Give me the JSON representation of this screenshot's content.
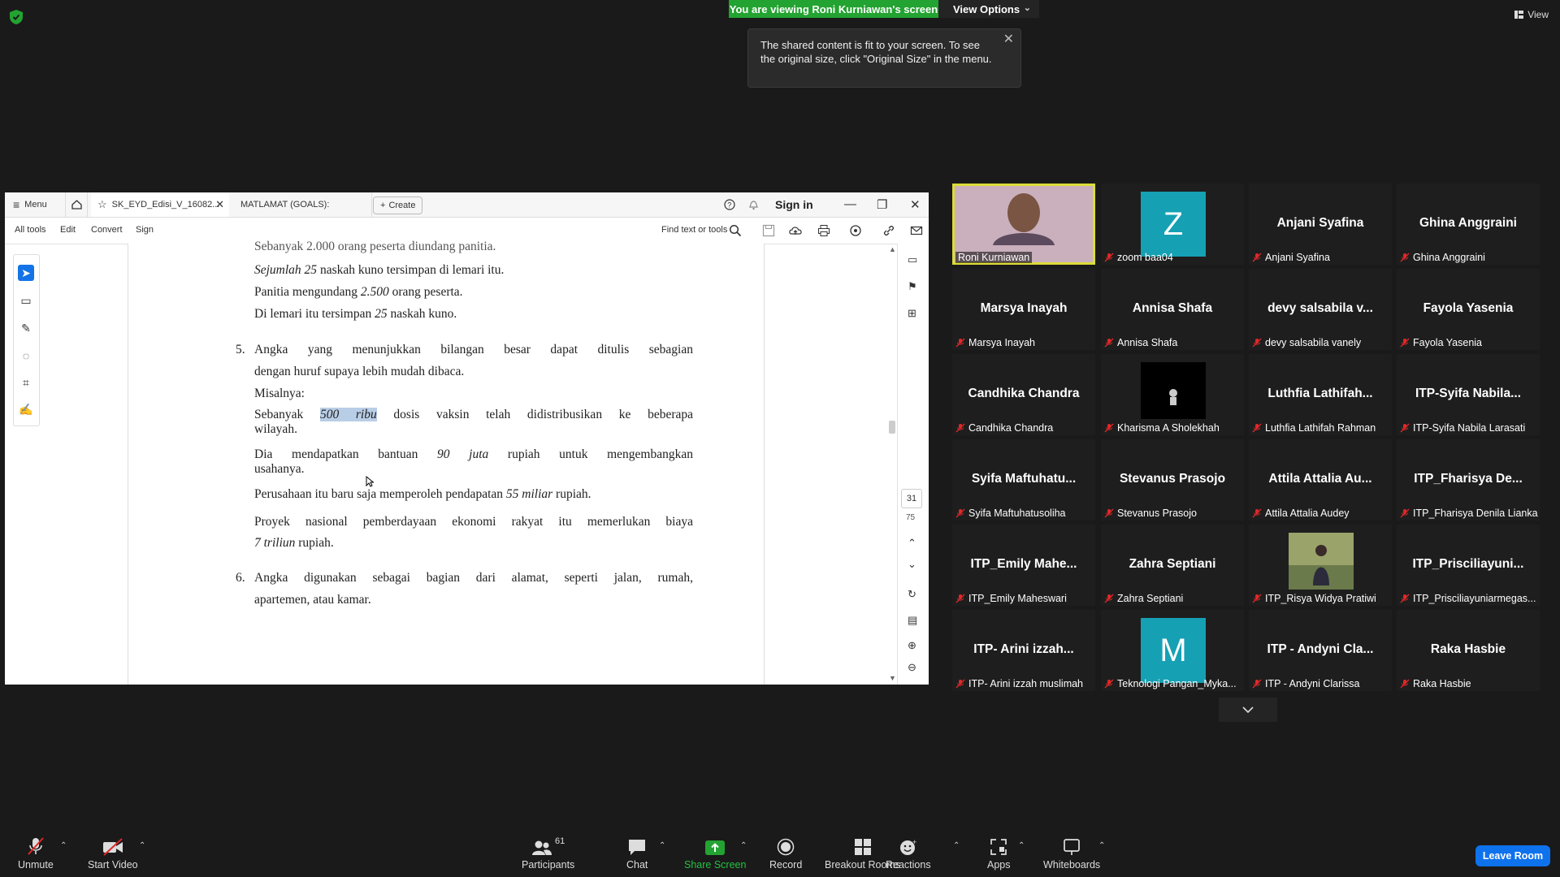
{
  "banner": {
    "viewing": "You are viewing Roni Kurniawan's screen",
    "view_options": "View Options",
    "view_top_right": "View"
  },
  "tooltip": {
    "text": "The shared content is fit to your screen. To see the original size, click \"Original Size\" in the menu."
  },
  "pdf": {
    "tabs": {
      "menu": "Menu",
      "doc": "SK_EYD_Edisi_V_16082...",
      "goals": "MATLAMAT (GOALS):",
      "create": "Create"
    },
    "sign_in": "Sign in",
    "menu2": {
      "all_tools": "All tools",
      "edit": "Edit",
      "convert": "Convert",
      "sign": "Sign",
      "find": "Find text or tools"
    },
    "page_current": "31",
    "page_total": "75",
    "lines": {
      "l0": "Sebanyak 2.000 orang peserta diundang panitia.",
      "l1a": "Sejumlah 25",
      "l1b": " naskah kuno tersimpan di lemari itu.",
      "l2a": "Panitia mengundang ",
      "l2b": "2.500",
      "l2c": " orang peserta.",
      "l3a": "Di lemari itu tersimpan ",
      "l3b": "25",
      "l3c": " naskah kuno.",
      "n5": "5.",
      "p5a": "Angka yang menunjukkan bilangan besar dapat ditulis sebagian",
      "p5b": "dengan huruf supaya lebih mudah dibaca.",
      "misal": "Misalnya:",
      "e1a": "Sebanyak ",
      "e1b": "500 ribu",
      "e1c": " dosis vaksin telah didistribusikan ke beberapa",
      "e1d": "wilayah.",
      "e2a": "Dia mendapatkan bantuan ",
      "e2b": "90 juta",
      "e2c": " rupiah untuk mengembangkan",
      "e2d": "usahanya.",
      "e3a": "Perusahaan itu baru saja memperoleh pendapatan ",
      "e3b": "55 miliar",
      "e3c": " rupiah.",
      "e4a": "Proyek nasional pemberdayaan ekonomi rakyat itu memerlukan biaya",
      "e4b": "7 triliun",
      "e4c": " rupiah.",
      "n6": "6.",
      "p6a": "Angka digunakan sebagai bagian dari alamat, seperti jalan, rumah,",
      "p6b": "apartemen, atau kamar."
    }
  },
  "participants": [
    {
      "name": "",
      "label": "Roni Kurniawan",
      "muted": false
    },
    {
      "name": "",
      "label": "zoom baa04",
      "avatar": "Z",
      "muted": true
    },
    {
      "name": "Anjani Syafina",
      "label": "Anjani Syafina",
      "muted": true
    },
    {
      "name": "Ghina Anggraini",
      "label": "Ghina Anggraini",
      "muted": true
    },
    {
      "name": "Marsya Inayah",
      "label": "Marsya Inayah",
      "muted": true
    },
    {
      "name": "Annisa Shafa",
      "label": "Annisa Shafa",
      "muted": true
    },
    {
      "name": "devy salsabila v...",
      "label": "devy salsabila vanely",
      "muted": true
    },
    {
      "name": "Fayola Yasenia",
      "label": "Fayola Yasenia",
      "muted": true
    },
    {
      "name": "Candhika Chandra",
      "label": "Candhika Chandra",
      "muted": true
    },
    {
      "name": "",
      "label": "Kharisma A Sholekhah",
      "muted": true
    },
    {
      "name": "Luthfia Lathifah...",
      "label": "Luthfia Lathifah Rahman",
      "muted": true
    },
    {
      "name": "ITP-Syifa Nabila...",
      "label": "ITP-Syifa Nabila Larasati",
      "muted": true
    },
    {
      "name": "Syifa Maftuhatu...",
      "label": "Syifa Maftuhatusoliha",
      "muted": true
    },
    {
      "name": "Stevanus Prasojo",
      "label": "Stevanus Prasojo",
      "muted": true
    },
    {
      "name": "Attila Attalia Au...",
      "label": "Attila Attalia Audey",
      "muted": true
    },
    {
      "name": "ITP_Fharisya De...",
      "label": "ITP_Fharisya Denila Lianka",
      "muted": true
    },
    {
      "name": "ITP_Emily Mahe...",
      "label": "ITP_Emily Maheswari",
      "muted": true
    },
    {
      "name": "Zahra Septiani",
      "label": "Zahra Septiani",
      "muted": true
    },
    {
      "name": "",
      "label": "ITP_Risya Widya Pratiwi",
      "muted": true
    },
    {
      "name": "ITP_Prisciliayuni...",
      "label": "ITP_Prisciliayuniarmegas...",
      "muted": true
    },
    {
      "name": "ITP- Arini izzah...",
      "label": "ITP- Arini izzah muslimah",
      "muted": true
    },
    {
      "name": "",
      "label": "Teknologi Pangan_Myka...",
      "avatar": "M",
      "muted": true
    },
    {
      "name": "ITP - Andyni Cla...",
      "label": "ITP - Andyni Clarissa",
      "muted": true
    },
    {
      "name": "Raka Hasbie",
      "label": "Raka Hasbie",
      "muted": true
    }
  ],
  "toolbar": {
    "unmute": "Unmute",
    "start_video": "Start Video",
    "participants": "Participants",
    "participants_count": "61",
    "chat": "Chat",
    "share_screen": "Share Screen",
    "record": "Record",
    "breakout": "Breakout Rooms",
    "reactions": "Reactions",
    "apps": "Apps",
    "whiteboards": "Whiteboards",
    "leave": "Leave Room"
  },
  "colors": {
    "share_green": "#23a331",
    "leave_blue": "#0e72ed",
    "speaker_outline": "#dcdc3a",
    "avatar_teal": "#16a0b4",
    "muted_red": "#e02828"
  }
}
